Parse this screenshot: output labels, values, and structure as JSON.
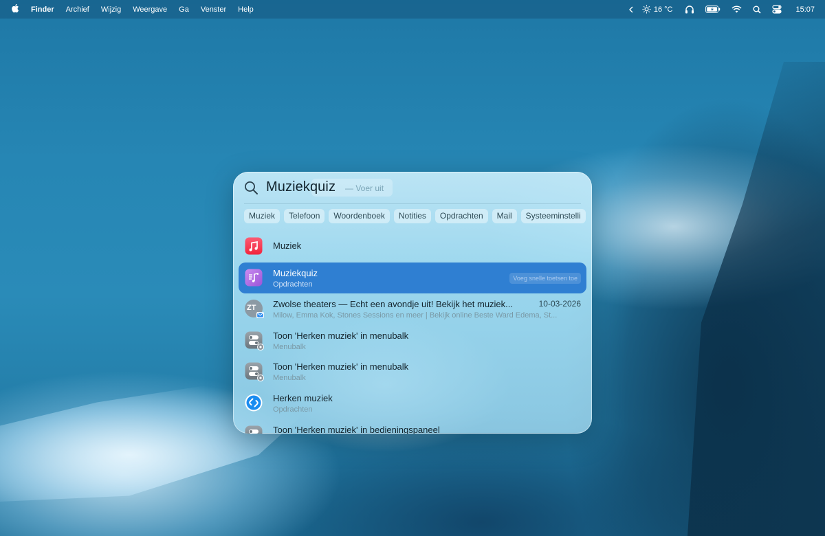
{
  "menubar": {
    "app": "Finder",
    "items": [
      "Archief",
      "Wijzig",
      "Weergave",
      "Ga",
      "Venster",
      "Help"
    ],
    "temperature": "16 °C",
    "clock": "15:07",
    "status_icons": [
      "chevron-left-icon",
      "sun-icon",
      "headphones-icon",
      "battery-icon",
      "wifi-icon",
      "search-icon",
      "control-center-icon"
    ]
  },
  "spotlight": {
    "query": "Muziekquiz",
    "hint": "—  Voer uit",
    "categories": [
      "Muziek",
      "Telefoon",
      "Woordenboek",
      "Notities",
      "Opdrachten",
      "Mail",
      "Systeeminstelli"
    ],
    "results": [
      {
        "title": "Muziek",
        "subtitle": "",
        "icon": "music-app-icon"
      },
      {
        "title": "Muziekquiz",
        "subtitle": "Opdrachten",
        "icon": "shortcut-music-icon",
        "selected": true,
        "shortcut_hint": "Voeg snelle toetsen toe"
      },
      {
        "title": "Zwolse theaters — Echt een avondje uit! Bekijk het muziek...",
        "subtitle": "Milow, Emma Kok, Stones Sessions en meer | Bekijk online Beste Ward Edema, St...",
        "date": "10-03-2026",
        "icon": "mail-avatar-icon",
        "avatar_initials": "ZT"
      },
      {
        "title": "Toon 'Herken muziek' in menubalk",
        "subtitle": "Menubalk",
        "icon": "settings-toggle-icon"
      },
      {
        "title": "Toon 'Herken muziek' in menubalk",
        "subtitle": "Menubalk",
        "icon": "settings-toggle-icon"
      },
      {
        "title": "Herken muziek",
        "subtitle": "Opdrachten",
        "icon": "shazam-icon"
      },
      {
        "title": "Toon 'Herken muziek' in bedieningspaneel",
        "subtitle": "",
        "icon": "settings-toggle-icon"
      }
    ]
  },
  "colors": {
    "selection": "#2f7fd2",
    "music_red": "#f5384f",
    "shortcut_purple": "#b86ee0",
    "shazam_blue": "#1a8cf0"
  }
}
